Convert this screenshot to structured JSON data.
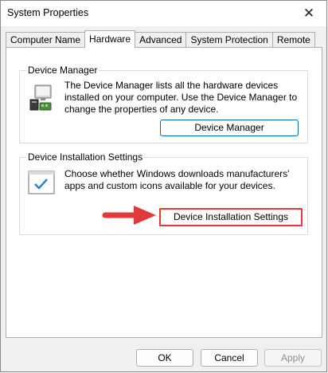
{
  "window": {
    "title": "System Properties"
  },
  "tabs": [
    {
      "label": "Computer Name"
    },
    {
      "label": "Hardware"
    },
    {
      "label": "Advanced"
    },
    {
      "label": "System Protection"
    },
    {
      "label": "Remote"
    }
  ],
  "device_manager": {
    "group_label": "Device Manager",
    "description": "The Device Manager lists all the hardware devices installed on your computer. Use the Device Manager to change the properties of any device.",
    "button_label": "Device Manager"
  },
  "device_installation": {
    "group_label": "Device Installation Settings",
    "description": "Choose whether Windows downloads manufacturers' apps and custom icons available for your devices.",
    "button_label": "Device Installation Settings"
  },
  "footer": {
    "ok_label": "OK",
    "cancel_label": "Cancel",
    "apply_label": "Apply"
  },
  "icons": {
    "close": "close-icon",
    "device_manager": "device-manager-icon",
    "device_installation": "checkmark-window-icon",
    "annotation": "red-arrow-icon"
  },
  "colors": {
    "accent": "#0067c0",
    "annotation": "#e23a3a"
  }
}
